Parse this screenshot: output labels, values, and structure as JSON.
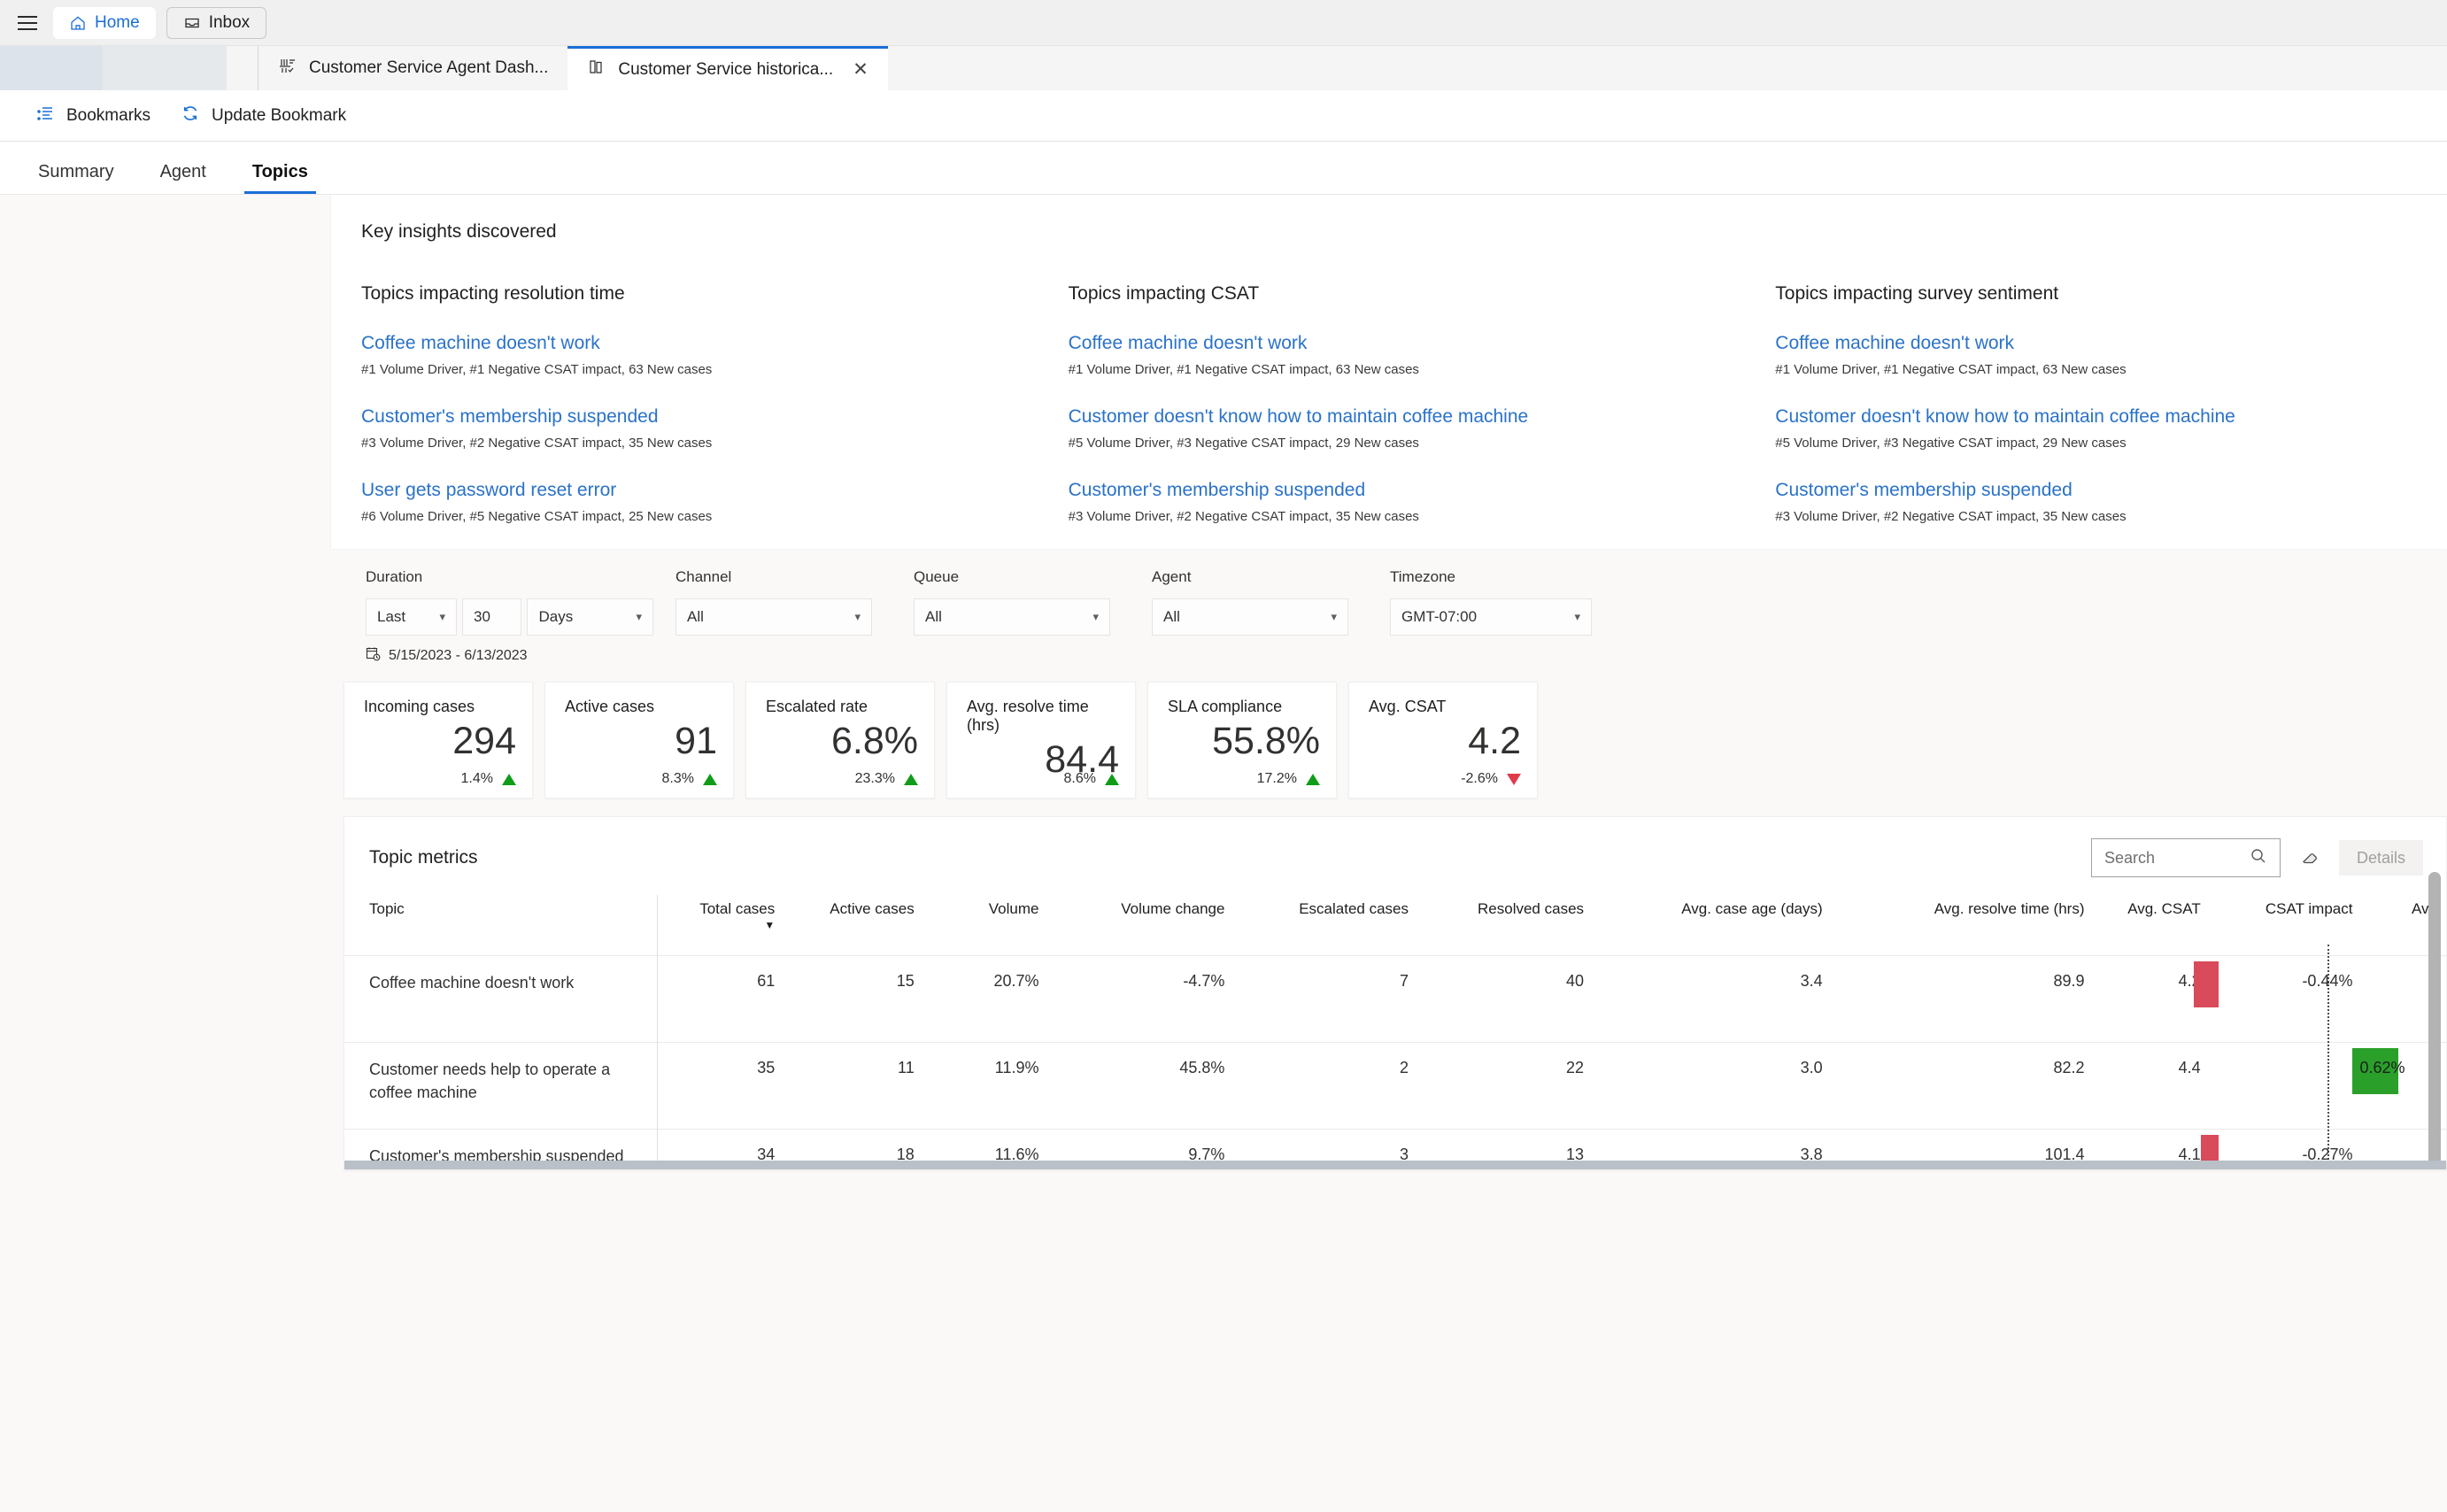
{
  "app_header": {
    "menu_icon": "hamburger-icon",
    "nav": [
      {
        "label": "Home",
        "icon": "home-icon"
      },
      {
        "label": "Inbox",
        "icon": "inbox-icon"
      }
    ]
  },
  "tabs": [
    {
      "label": "Customer Service Agent Dash...",
      "icon": "dashboard-icon",
      "active": false
    },
    {
      "label": "Customer Service historica...",
      "icon": "report-icon",
      "active": true,
      "close": "✕"
    }
  ],
  "commandbar": {
    "items": [
      {
        "label": "Bookmarks",
        "icon": "bookmarks-icon"
      },
      {
        "label": "Update Bookmark",
        "icon": "refresh-icon"
      }
    ]
  },
  "pagetabs": [
    {
      "label": "Summary",
      "selected": false
    },
    {
      "label": "Agent",
      "selected": false
    },
    {
      "label": "Topics",
      "selected": true
    }
  ],
  "insights": {
    "title": "Key insights discovered",
    "columns": [
      {
        "heading": "Topics impacting resolution time",
        "items": [
          {
            "link": "Coffee machine doesn't work",
            "sub": "#1 Volume Driver, #1 Negative CSAT impact, 63 New cases"
          },
          {
            "link": "Customer's membership suspended",
            "sub": "#3 Volume Driver, #2 Negative CSAT impact, 35 New cases"
          },
          {
            "link": "User gets password reset error",
            "sub": "#6 Volume Driver, #5 Negative CSAT impact, 25 New cases"
          }
        ]
      },
      {
        "heading": "Topics impacting CSAT",
        "items": [
          {
            "link": "Coffee machine doesn't work",
            "sub": "#1 Volume Driver, #1 Negative CSAT impact, 63 New cases"
          },
          {
            "link": "Customer doesn't know how to maintain coffee machine",
            "sub": "#5 Volume Driver, #3 Negative CSAT impact, 29 New cases"
          },
          {
            "link": "Customer's membership suspended",
            "sub": "#3 Volume Driver, #2 Negative CSAT impact, 35 New cases"
          }
        ]
      },
      {
        "heading": "Topics impacting survey sentiment",
        "items": [
          {
            "link": "Coffee machine doesn't work",
            "sub": "#1 Volume Driver, #1 Negative CSAT impact, 63 New cases"
          },
          {
            "link": "Customer doesn't know how to maintain coffee machine",
            "sub": "#5 Volume Driver, #3 Negative CSAT impact, 29 New cases"
          },
          {
            "link": "Customer's membership suspended",
            "sub": "#3 Volume Driver, #2 Negative CSAT impact, 35 New cases"
          }
        ]
      }
    ]
  },
  "filters": {
    "duration": {
      "label": "Duration",
      "relative": "Last",
      "amount": "30",
      "unit": "Days",
      "daterange": "5/15/2023 - 6/13/2023",
      "daterange_icon": "calendar-clock-icon"
    },
    "channel": {
      "label": "Channel",
      "value": "All"
    },
    "queue": {
      "label": "Queue",
      "value": "All"
    },
    "agent": {
      "label": "Agent",
      "value": "All"
    },
    "timezone": {
      "label": "Timezone",
      "value": "GMT-07:00"
    }
  },
  "kpis": [
    {
      "title": "Incoming cases",
      "value": "294",
      "delta": "1.4%",
      "direction": "up"
    },
    {
      "title": "Active cases",
      "value": "91",
      "delta": "8.3%",
      "direction": "up"
    },
    {
      "title": "Escalated rate",
      "value": "6.8%",
      "delta": "23.3%",
      "direction": "up"
    },
    {
      "title": "Avg. resolve time (hrs)",
      "value": "84.4",
      "delta": "8.6%",
      "direction": "up"
    },
    {
      "title": "SLA compliance",
      "value": "55.8%",
      "delta": "17.2%",
      "direction": "up"
    },
    {
      "title": "Avg. CSAT",
      "value": "4.2",
      "delta": "-2.6%",
      "direction": "down"
    }
  ],
  "metrics": {
    "title": "Topic metrics",
    "search_placeholder": "Search",
    "search_icon": "search-icon",
    "eraser_icon": "eraser-icon",
    "details_label": "Details",
    "sort_column": "Total cases",
    "sort_caret": "▼",
    "columns": [
      "Topic",
      "Total cases",
      "Active cases",
      "Volume",
      "Volume change",
      "Escalated cases",
      "Resolved cases",
      "Avg. case age (days)",
      "Avg. resolve time (hrs)",
      "Avg. CSAT",
      "CSAT impact",
      "Avg"
    ],
    "rows": [
      {
        "topic": "Coffee machine doesn't work",
        "total_cases": "61",
        "active_cases": "15",
        "volume": "20.7%",
        "volume_change": "-4.7%",
        "escalated_cases": "7",
        "resolved_cases": "40",
        "avg_case_age": "3.4",
        "avg_resolve_time": "89.9",
        "avg_csat": "4.2",
        "csat_impact": "-0.44%",
        "csat_impact_dir": "negative",
        "csat_impact_mag": 28
      },
      {
        "topic": "Customer needs help to operate a coffee machine",
        "total_cases": "35",
        "active_cases": "11",
        "volume": "11.9%",
        "volume_change": "45.8%",
        "escalated_cases": "2",
        "resolved_cases": "22",
        "avg_case_age": "3.0",
        "avg_resolve_time": "82.2",
        "avg_csat": "4.4",
        "csat_impact": "0.62%",
        "csat_impact_dir": "positive",
        "csat_impact_mag": 52
      },
      {
        "topic": "Customer's membership suspended",
        "total_cases": "34",
        "active_cases": "18",
        "volume": "11.6%",
        "volume_change": "9.7%",
        "escalated_cases": "3",
        "resolved_cases": "13",
        "avg_case_age": "3.8",
        "avg_resolve_time": "101.4",
        "avg_csat": "4.1",
        "csat_impact": "-0.27%",
        "csat_impact_dir": "negative",
        "csat_impact_mag": 20
      }
    ]
  },
  "colors": {
    "accent": "#1a6ed8",
    "link": "#2a72c9",
    "positive": "#0f9d18",
    "negative": "#e03b4a",
    "bar_positive": "#2aa02a",
    "bar_negative": "#d94a5a"
  }
}
